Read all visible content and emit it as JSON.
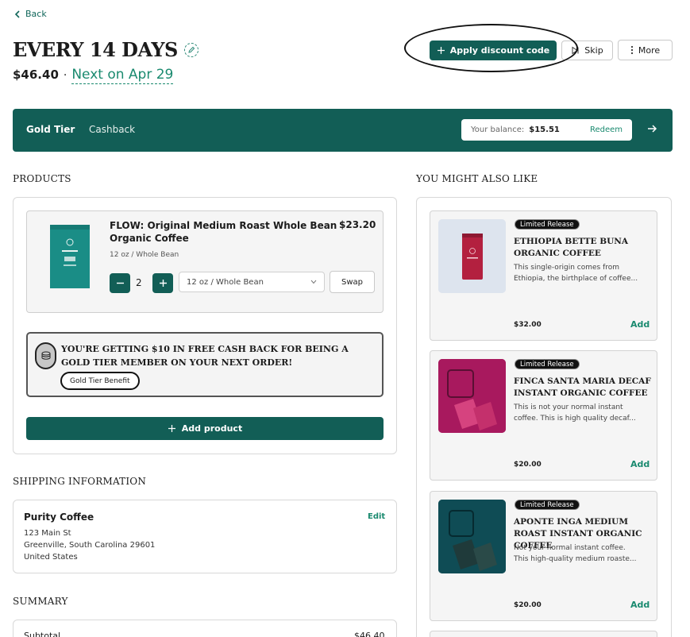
{
  "header": {
    "back_label": "Back",
    "title": "EVERY 14 DAYS",
    "price": "$46.40",
    "separator": "·",
    "next_label": "Next on Apr 29"
  },
  "actions": {
    "apply_discount": "Apply discount code",
    "skip": "Skip",
    "more": "More"
  },
  "banner": {
    "tier": "Gold Tier",
    "cashback": "Cashback",
    "balance_label": "Your balance:",
    "balance_amount": "$15.51",
    "redeem": "Redeem"
  },
  "products": {
    "heading": "PRODUCTS",
    "item": {
      "title": "FLOW: Original Medium Roast Whole Bean Organic Coffee",
      "price": "$23.20",
      "variant": "12 oz / Whole Bean",
      "quantity": "2",
      "select_value": "12 oz / Whole Bean",
      "swap": "Swap",
      "image_brand": "PURITY"
    },
    "cashback_text": "YOU'RE GETTING $10 IN FREE CASH BACK FOR BEING A GOLD TIER MEMBER ON YOUR NEXT ORDER!",
    "cashback_badge": "Gold Tier Benefit",
    "add_product": "Add product"
  },
  "shipping": {
    "heading": "SHIPPING INFORMATION",
    "name": "Purity Coffee",
    "edit": "Edit",
    "address_line1": "123 Main St",
    "address_line2": "Greenville, South Carolina 29601",
    "country": "United States"
  },
  "summary": {
    "heading": "SUMMARY",
    "subtotal_label": "Subtotal",
    "subtotal_value": "$46.40"
  },
  "recommendations": {
    "heading": "YOU MIGHT ALSO LIKE",
    "items": [
      {
        "badge": "Limited Release",
        "title": "ETHIOPIA BETTE BUNA ORGANIC COFFEE",
        "desc1": "This single-origin comes from",
        "desc2": "Ethiopia, the birthplace of coffee...",
        "price": "$32.00",
        "add": "Add"
      },
      {
        "badge": "Limited Release",
        "title": "FINCA SANTA MARIA DECAF INSTANT ORGANIC COFFEE",
        "desc1": "This is not your normal instant",
        "desc2": "coffee. This is high quality decaf...",
        "price": "$20.00",
        "add": "Add"
      },
      {
        "badge": "Limited Release",
        "title": "APONTE INGA MEDIUM ROAST INSTANT ORGANIC COFFEE",
        "desc1": "Not your normal instant coffee.",
        "desc2": "This high-quality medium roaste...",
        "price": "$20.00",
        "add": "Add"
      }
    ]
  },
  "colors": {
    "brand": "#125e56",
    "accent": "#1a8a6f",
    "rec1_image": "#b3203f",
    "rec2_image": "#a8195e",
    "rec3_image": "#0f4c55"
  }
}
